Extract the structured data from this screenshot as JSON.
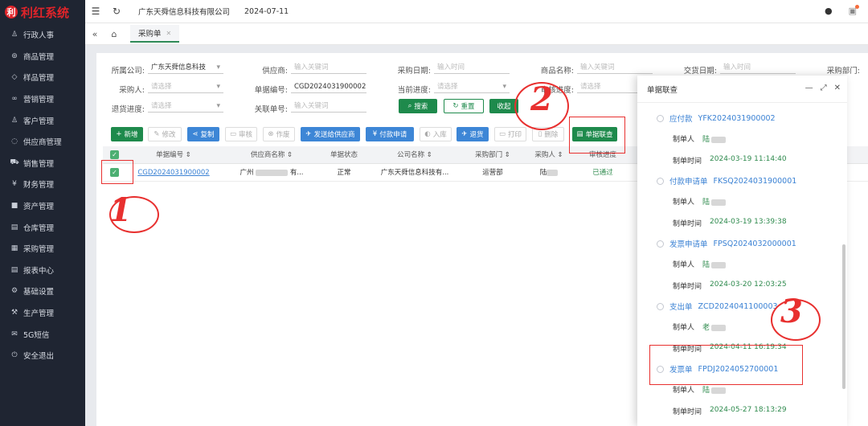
{
  "app": {
    "logo_text": "利红系统",
    "logo_mark": "利"
  },
  "sidebar": {
    "items": [
      {
        "label": "行政人事",
        "icon": "person-icon",
        "glyph": "♙"
      },
      {
        "label": "商品管理",
        "icon": "box-icon",
        "glyph": "⊚"
      },
      {
        "label": "样品管理",
        "icon": "tag-icon",
        "glyph": "◇"
      },
      {
        "label": "营销管理",
        "icon": "handshake-icon",
        "glyph": "∞"
      },
      {
        "label": "客户管理",
        "icon": "user-icon",
        "glyph": "♙"
      },
      {
        "label": "供应商管理",
        "icon": "shield-icon",
        "glyph": "◌"
      },
      {
        "label": "销售管理",
        "icon": "cart-icon",
        "glyph": "⛟"
      },
      {
        "label": "财务管理",
        "icon": "money-icon",
        "glyph": "¥"
      },
      {
        "label": "资产管理",
        "icon": "asset-icon",
        "glyph": "■"
      },
      {
        "label": "仓库管理",
        "icon": "warehouse-icon",
        "glyph": "▤"
      },
      {
        "label": "采购管理",
        "icon": "purchase-icon",
        "glyph": "▦"
      },
      {
        "label": "报表中心",
        "icon": "report-icon",
        "glyph": "▤"
      },
      {
        "label": "基础设置",
        "icon": "gear-icon",
        "glyph": "⚙"
      },
      {
        "label": "生产管理",
        "icon": "production-icon",
        "glyph": "⚒"
      },
      {
        "label": "5G短信",
        "icon": "message-icon",
        "glyph": "✉"
      },
      {
        "label": "安全退出",
        "icon": "power-icon",
        "glyph": "⏻"
      }
    ]
  },
  "header": {
    "company": "广东天舜信息科技有限公司",
    "date": "2024-07-11"
  },
  "tabs": [
    {
      "label": "采购单"
    }
  ],
  "filters": {
    "company_label": "所属公司:",
    "company_value": "广东天舜信息科技",
    "supplier_label": "供应商:",
    "supplier_placeholder": "输入关键词",
    "purchase_date_label": "采购日期:",
    "purchase_date_placeholder": "输入时间",
    "goods_label": "商品名称:",
    "goods_placeholder": "输入关键词",
    "trade_date_label": "交货日期:",
    "trade_date_placeholder": "输入时间",
    "dept_label": "采购部门:",
    "buyer_label": "采购人:",
    "buyer_placeholder": "请选择",
    "order_no_label": "单据编号:",
    "order_no_value": "CGD2024031900002",
    "current_progress_label": "当前进度:",
    "current_progress_placeholder": "请选择",
    "audit_progress_label": "审核进度:",
    "audit_progress_placeholder": "请选择",
    "return_progress_label": "退货进度:",
    "return_progress_placeholder": "请选择",
    "related_no_label": "关联单号:",
    "related_no_placeholder": "输入关键词",
    "search_label": "搜索",
    "reset_label": "重置",
    "collapse_label": "收起"
  },
  "toolbar": {
    "add": "新增",
    "edit": "修改",
    "copy": "复制",
    "audit": "审核",
    "void": "作废",
    "send_supplier": "发送给供应商",
    "pay_apply": "付款申请",
    "stock_in": "入库",
    "return": "退货",
    "print": "打印",
    "delete": "删除",
    "linked_query": "单据联查"
  },
  "table": {
    "headers": [
      "单据编号",
      "供应商名称",
      "单据状态",
      "公司名称",
      "采购部门",
      "采购人",
      "审核进度"
    ],
    "row": {
      "order_no": "CGD2024031900002",
      "supplier_a": "广州",
      "supplier_b": "有...",
      "status": "正常",
      "company": "广东天舜信息科技有...",
      "dept": "运营部",
      "buyer": "陆",
      "audit": "已通过"
    }
  },
  "panel": {
    "title": "单据联查",
    "items": [
      {
        "type": "应付款",
        "no": "YFK2024031900002",
        "maker_label": "制单人",
        "maker": "陆",
        "time_label": "制单时间",
        "time": "2024-03-19 11:14:40"
      },
      {
        "type": "付款申请单",
        "no": "FKSQ2024031900001",
        "maker_label": "制单人",
        "maker": "陆",
        "time_label": "制单时间",
        "time": "2024-03-19 13:39:38"
      },
      {
        "type": "发票申请单",
        "no": "FPSQ2024032000001",
        "maker_label": "制单人",
        "maker": "陆",
        "time_label": "制单时间",
        "time": "2024-03-20 12:03:25"
      },
      {
        "type": "支出单",
        "no": "ZCD2024041100003",
        "maker_label": "制单人",
        "maker": "老",
        "time_label": "制单时间",
        "time": "2024-04-11 16:19:34"
      },
      {
        "type": "发票单",
        "no": "FPDJ2024052700001",
        "maker_label": "制单人",
        "maker": "陆",
        "time_label": "制单时间",
        "time": "2024-05-27 18:13:29"
      }
    ]
  },
  "annotations": {
    "one": "1",
    "two": "2",
    "three": "3"
  },
  "colors": {
    "sidebar_bg": "#1f2532",
    "brand_red": "#e0242a",
    "primary_green": "#1e8a4c",
    "action_blue": "#3d86d6",
    "annotation_red": "#e8302f"
  }
}
